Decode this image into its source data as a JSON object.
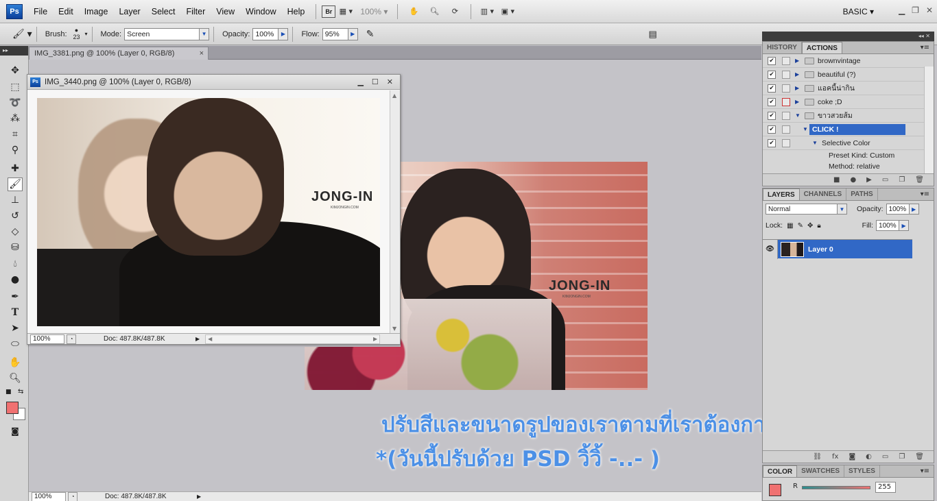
{
  "menubar": {
    "logo": "Ps",
    "items": [
      "File",
      "Edit",
      "Image",
      "Layer",
      "Select",
      "Filter",
      "View",
      "Window",
      "Help"
    ],
    "bridge": "Br",
    "zoom": "100%",
    "workspace": "BASIC"
  },
  "options": {
    "brush_label": "Brush:",
    "brush_size": "23",
    "mode_label": "Mode:",
    "mode_value": "Screen",
    "opacity_label": "Opacity:",
    "opacity_value": "100%",
    "flow_label": "Flow:",
    "flow_value": "95%"
  },
  "doc_tab": {
    "title": "IMG_3381.png @ 100% (Layer 0, RGB/8)",
    "close": "×"
  },
  "doc_window": {
    "title": "IMG_3440.png @ 100% (Layer 0, RGB/8)",
    "zoom": "100%",
    "doc_info": "Doc: 487.8K/487.8K"
  },
  "main_status": {
    "zoom": "100%",
    "doc_info": "Doc: 487.8K/487.8K"
  },
  "image_logo": {
    "text": "JONG-IN",
    "sub": "KIMJONGIN.COM"
  },
  "overlay": {
    "line1": "ปรับสีและขนาดรูปของเราตามที่เราต้องการ",
    "line2": "*(วันนี้ปรับด้วย PSD วิ้วิ้ -..- )"
  },
  "actions_panel": {
    "tabs": [
      "HISTORY",
      "ACTIONS"
    ],
    "active_tab": "ACTIONS",
    "rows": [
      {
        "label": "brownvintage",
        "kind": "set"
      },
      {
        "label": "beautiful (?)",
        "kind": "set"
      },
      {
        "label": "แอคนี้น่ากิน",
        "kind": "set"
      },
      {
        "label": "coke ;D",
        "kind": "set"
      },
      {
        "label": "ขาวสวยส้ม",
        "kind": "set-open"
      },
      {
        "label": "CLICK !",
        "kind": "action-selected"
      },
      {
        "label": "Selective Color",
        "kind": "step"
      },
      {
        "label": "Preset Kind: Custom",
        "kind": "detail"
      },
      {
        "label": "Method: relative",
        "kind": "detail"
      }
    ]
  },
  "layers_panel": {
    "tabs": [
      "LAYERS",
      "CHANNELS",
      "PATHS"
    ],
    "blend_mode": "Normal",
    "opacity_label": "Opacity:",
    "opacity_value": "100%",
    "lock_label": "Lock:",
    "fill_label": "Fill:",
    "fill_value": "100%",
    "layer_name": "Layer 0"
  },
  "color_panel": {
    "tabs": [
      "COLOR",
      "SWATCHES",
      "STYLES"
    ],
    "r_label": "R",
    "r_value": "255",
    "foreground": "#f07171"
  }
}
